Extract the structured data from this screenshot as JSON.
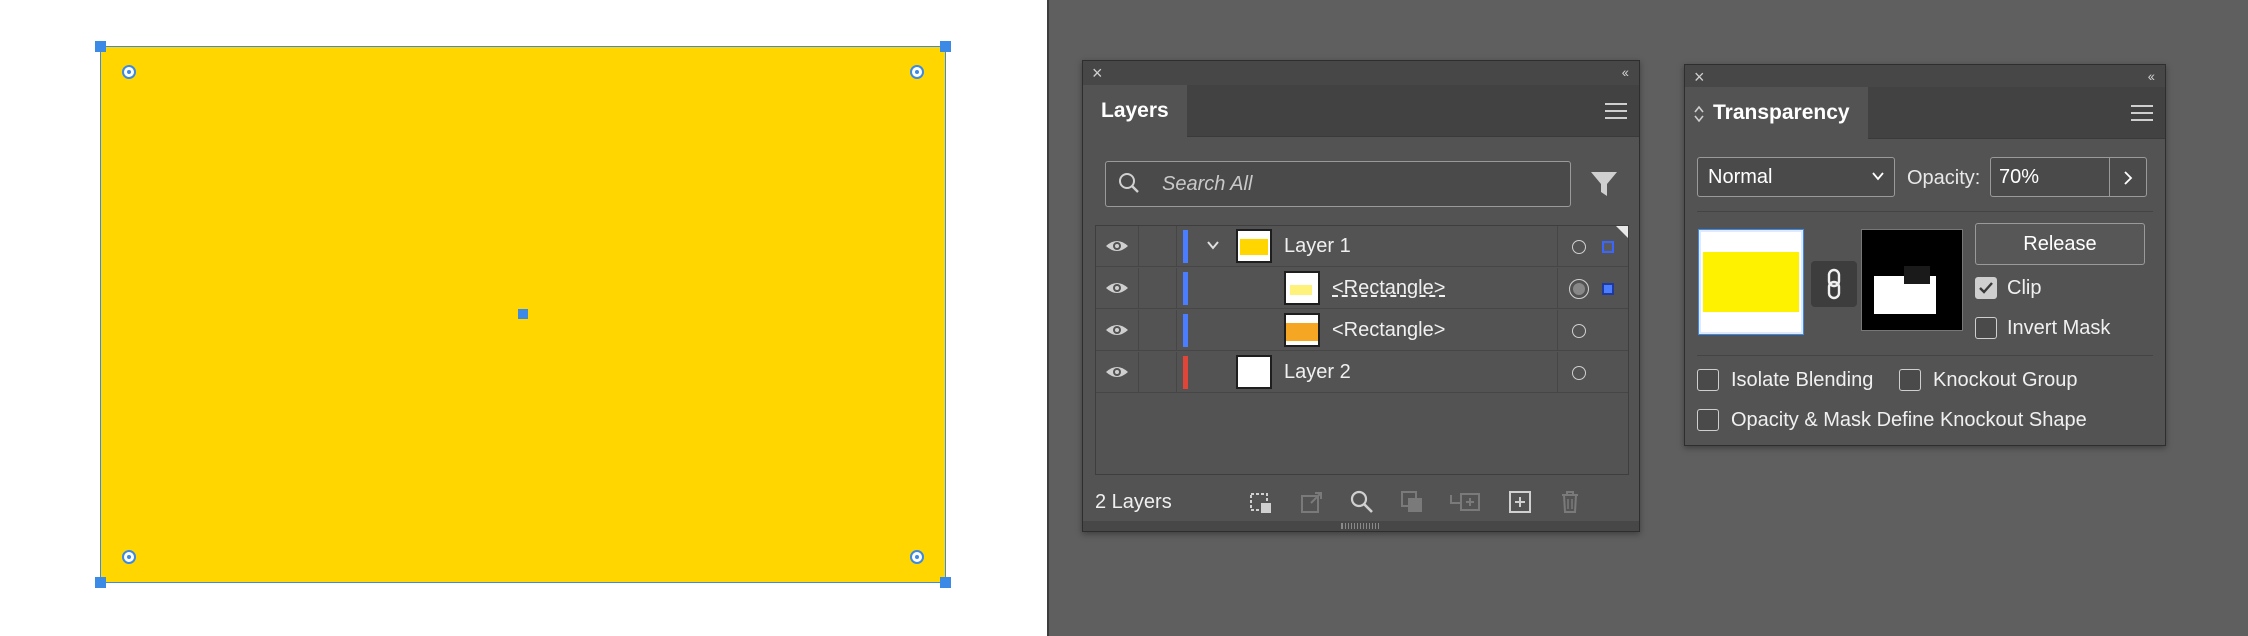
{
  "colors": {
    "artwork_fill": "#ffd600",
    "selection": "#3b8ae6",
    "panel_bg": "#535353"
  },
  "layers_panel": {
    "tab_label": "Layers",
    "search_placeholder": "Search All",
    "rows": [
      {
        "name": "Layer 1",
        "kind": "layer",
        "expanded": true,
        "color": "#4a7dff"
      },
      {
        "name": "<Rectangle>",
        "kind": "object",
        "selected": true,
        "color": "#4a7dff"
      },
      {
        "name": "<Rectangle>",
        "kind": "object",
        "color": "#4a7dff"
      },
      {
        "name": "Layer 2",
        "kind": "layer",
        "color": "#e0453a"
      }
    ],
    "footer_count": "2 Layers",
    "footer_icons": [
      "collect-for-export-icon",
      "export-icon",
      "locate-object-icon",
      "make-clipping-mask-icon",
      "new-sublayer-icon",
      "new-layer-icon",
      "delete-icon"
    ]
  },
  "transparency_panel": {
    "tab_label": "Transparency",
    "blend_mode": "Normal",
    "opacity_label": "Opacity:",
    "opacity_value": "70%",
    "release_label": "Release",
    "clip_label": "Clip",
    "clip_checked": true,
    "invert_mask_label": "Invert Mask",
    "invert_mask_checked": false,
    "isolate_blending_label": "Isolate Blending",
    "knockout_group_label": "Knockout Group",
    "opacity_mask_label": "Opacity & Mask Define Knockout Shape"
  }
}
